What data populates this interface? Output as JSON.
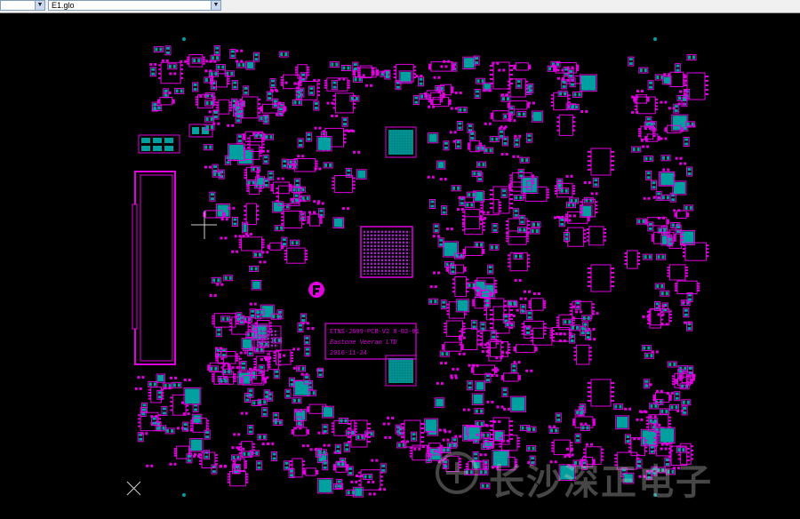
{
  "toolbar": {
    "combo_left_value": "",
    "combo_file_value": "E1.glo"
  },
  "board": {
    "silkscreen_lines": [
      "ETNS-J609-PCB-V2 0-B3-01",
      "Eastone Veeran LTD",
      "2016-11-24"
    ],
    "colors": {
      "background": "#000000",
      "silkscreen": "#e000e0",
      "copper": "#00a0a0",
      "cursor": "#d0d0d0"
    }
  },
  "watermark": {
    "text": "长沙深正电子"
  }
}
